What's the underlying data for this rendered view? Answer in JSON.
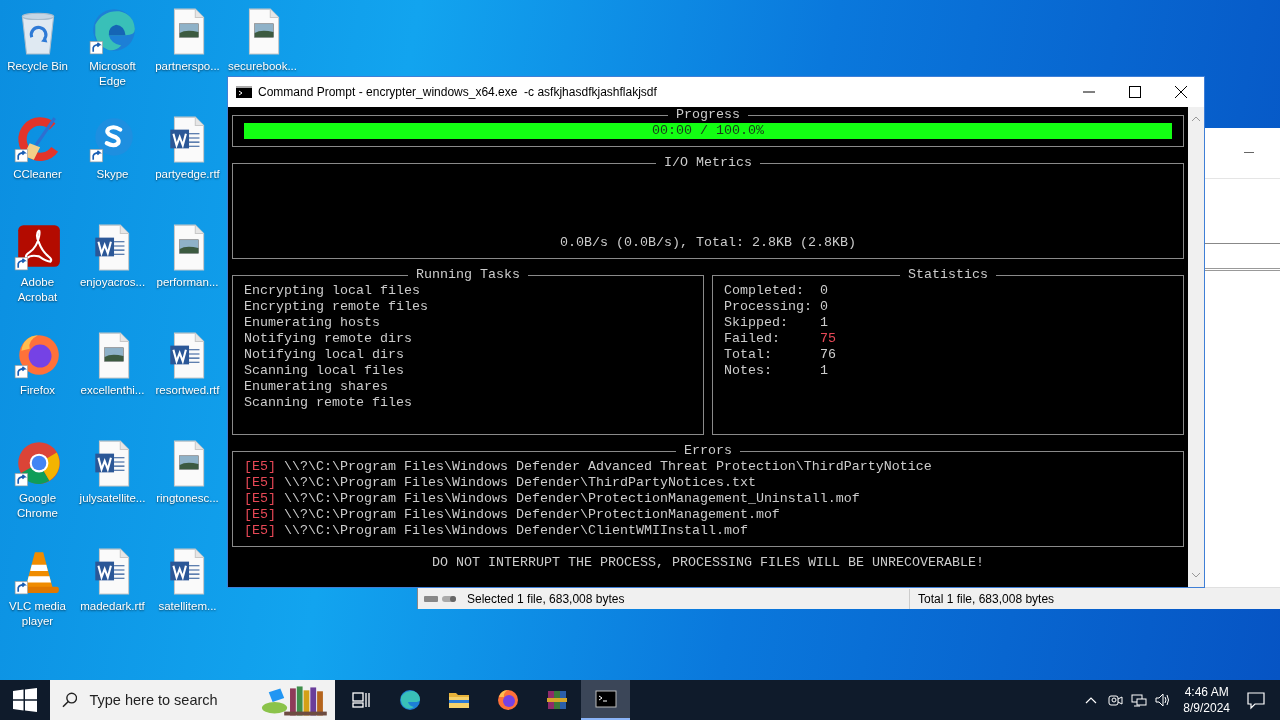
{
  "desktop": {
    "icons": [
      {
        "label": "Recycle Bin",
        "kind": "recycle",
        "shortcut": false
      },
      {
        "label": "CCleaner",
        "kind": "ccleaner",
        "shortcut": true
      },
      {
        "label": "Adobe Acrobat",
        "kind": "acrobat",
        "shortcut": true
      },
      {
        "label": "Firefox",
        "kind": "firefox",
        "shortcut": true
      },
      {
        "label": "Google Chrome",
        "kind": "chrome",
        "shortcut": true
      },
      {
        "label": "VLC media player",
        "kind": "vlc",
        "shortcut": true
      },
      {
        "label": "Microsoft Edge",
        "kind": "edge",
        "shortcut": true
      },
      {
        "label": "Skype",
        "kind": "skype",
        "shortcut": true
      },
      {
        "label": "enjoyacros...",
        "kind": "word",
        "shortcut": false
      },
      {
        "label": "excellenthi...",
        "kind": "image",
        "shortcut": false
      },
      {
        "label": "julysatellite...",
        "kind": "word",
        "shortcut": false
      },
      {
        "label": "madedark.rtf",
        "kind": "word",
        "shortcut": false
      },
      {
        "label": "partnerspo...",
        "kind": "image",
        "shortcut": false
      },
      {
        "label": "partyedge.rtf",
        "kind": "word",
        "shortcut": false
      },
      {
        "label": "performan...",
        "kind": "image",
        "shortcut": false
      },
      {
        "label": "resortwed.rtf",
        "kind": "word",
        "shortcut": false
      },
      {
        "label": "ringtonesc...",
        "kind": "image",
        "shortcut": false
      },
      {
        "label": "satellitem...",
        "kind": "word",
        "shortcut": false
      },
      {
        "label": "securebook...",
        "kind": "image",
        "shortcut": false
      }
    ]
  },
  "explorer_window": {
    "status_bar": {
      "selection": "Selected 1 file, 683,008 bytes",
      "total": "Total 1 file, 683,008 bytes"
    }
  },
  "console_window": {
    "title": "Command Prompt - encrypter_windows_x64.exe  -c asfkjhasdfkjashflakjsdf",
    "progress": {
      "title": "Progress",
      "level": 1,
      "text": "00:00 / 100.0%"
    },
    "io_metrics": {
      "title": "I/O Metrics",
      "text": "0.0B/s (0.0B/s), Total: 2.8KB (2.8KB)"
    },
    "running_tasks": {
      "title": "Running Tasks",
      "items": [
        "Encrypting local files",
        "Encrypting remote files",
        "Enumerating hosts",
        "Notifying remote dirs",
        "Notifying local dirs",
        "Scanning local files",
        "Enumerating shares",
        "Scanning remote files"
      ]
    },
    "statistics": {
      "title": "Statistics",
      "items": [
        {
          "label": "Completed:",
          "value": "0",
          "color": "#cccccc"
        },
        {
          "label": "Processing:",
          "value": "0",
          "color": "#cccccc"
        },
        {
          "label": "Skipped:",
          "value": "1",
          "color": "#cccccc"
        },
        {
          "label": "Failed:",
          "value": "75",
          "color": "#e74856"
        },
        {
          "label": "Total:",
          "value": "76",
          "color": "#cccccc"
        },
        {
          "label": "Notes:",
          "value": "1",
          "color": "#cccccc"
        }
      ]
    },
    "errors": {
      "title": "Errors",
      "items": [
        {
          "code": "[E5]",
          "path": "\\\\?\\C:\\Program Files\\Windows Defender Advanced Threat Protection\\ThirdPartyNotice"
        },
        {
          "code": "[E5]",
          "path": "\\\\?\\C:\\Program Files\\Windows Defender\\ThirdPartyNotices.txt"
        },
        {
          "code": "[E5]",
          "path": "\\\\?\\C:\\Program Files\\Windows Defender\\ProtectionManagement_Uninstall.mof"
        },
        {
          "code": "[E5]",
          "path": "\\\\?\\C:\\Program Files\\Windows Defender\\ProtectionManagement.mof"
        },
        {
          "code": "[E5]",
          "path": "\\\\?\\C:\\Program Files\\Windows Defender\\ClientWMIInstall.mof"
        }
      ]
    },
    "warning": "DO NOT INTERRUPT THE PROCESS, PROCESSING FILES WILL BE UNRECOVERABLE!"
  },
  "taskbar": {
    "search": {
      "placeholder": "Type here to search"
    },
    "apps": [
      {
        "kind": "taskview",
        "selected": false
      },
      {
        "kind": "edge",
        "selected": false
      },
      {
        "kind": "folder",
        "selected": false
      },
      {
        "kind": "firefox",
        "selected": false
      },
      {
        "kind": "archiver",
        "selected": false
      },
      {
        "kind": "console",
        "selected": true
      }
    ],
    "clock": {
      "time": "4:46 AM",
      "date": "8/9/2024"
    }
  }
}
